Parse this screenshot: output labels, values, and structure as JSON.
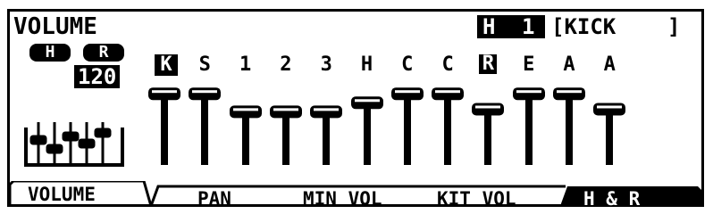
{
  "screen": {
    "title": "VOLUME",
    "header_mode": "H",
    "header_num": "1",
    "kit_name": "[KICK    ]",
    "pill_h": "H",
    "pill_r": "R",
    "value": "120",
    "icon": "mixer-faders-icon"
  },
  "channels": [
    {
      "label": "K",
      "selected": true,
      "level": 0.9
    },
    {
      "label": "S",
      "selected": false,
      "level": 0.9
    },
    {
      "label": "1",
      "selected": false,
      "level": 0.62
    },
    {
      "label": "2",
      "selected": false,
      "level": 0.62
    },
    {
      "label": "3",
      "selected": false,
      "level": 0.62
    },
    {
      "label": "H",
      "selected": false,
      "level": 0.76
    },
    {
      "label": "C",
      "selected": false,
      "level": 0.9
    },
    {
      "label": "C",
      "selected": false,
      "level": 0.9
    },
    {
      "label": "R",
      "selected": false,
      "level": 0.66,
      "inverted_label": true
    },
    {
      "label": "E",
      "selected": false,
      "level": 0.9
    },
    {
      "label": "A",
      "selected": false,
      "level": 0.9
    },
    {
      "label": "A",
      "selected": false,
      "level": 0.66
    }
  ],
  "tabs": [
    {
      "label": "VOLUME",
      "active": true
    },
    {
      "label": "PAN",
      "active": false
    },
    {
      "label": "MIN VOL",
      "active": false
    },
    {
      "label": "KIT VOL",
      "active": false
    },
    {
      "label": "H & R",
      "active": false,
      "inverted": true
    }
  ],
  "colors": {
    "ink": "#000000",
    "paper": "#ffffff"
  }
}
